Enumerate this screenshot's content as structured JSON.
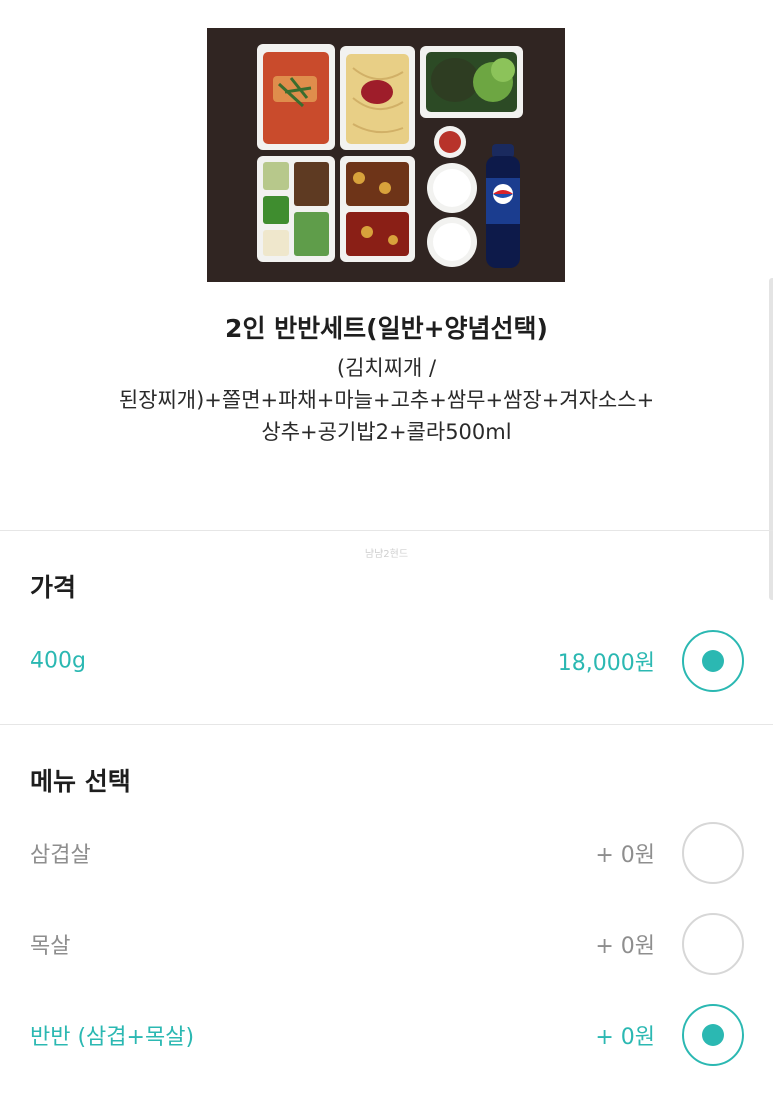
{
  "product": {
    "title": "2인 반반세트(일반+양념선택)",
    "description_lines": [
      "(김치찌개 /",
      "된장찌개)+쫄면+파채+마늘+고추+쌈무+쌈장+겨자소스+",
      "상추+공기밥2+콜라500ml"
    ]
  },
  "price_section": {
    "faint_note": "냠냠2현드",
    "title": "가격",
    "options": [
      {
        "name": "400g",
        "price": "18,000원",
        "selected": true
      }
    ]
  },
  "menu_section": {
    "title": "메뉴 선택",
    "options": [
      {
        "name": "삼겹살",
        "price": "+ 0원",
        "selected": false
      },
      {
        "name": "목살",
        "price": "+ 0원",
        "selected": false
      },
      {
        "name": "반반 (삼겹+목살)",
        "price": "+ 0원",
        "selected": true
      }
    ]
  },
  "colors": {
    "accent": "#2bb8b2",
    "muted": "#8e8e8e",
    "divider": "#e6e6e6"
  },
  "icons": {
    "radio_selected": "radio-selected-icon",
    "radio_unselected": "radio-unselected-icon"
  }
}
